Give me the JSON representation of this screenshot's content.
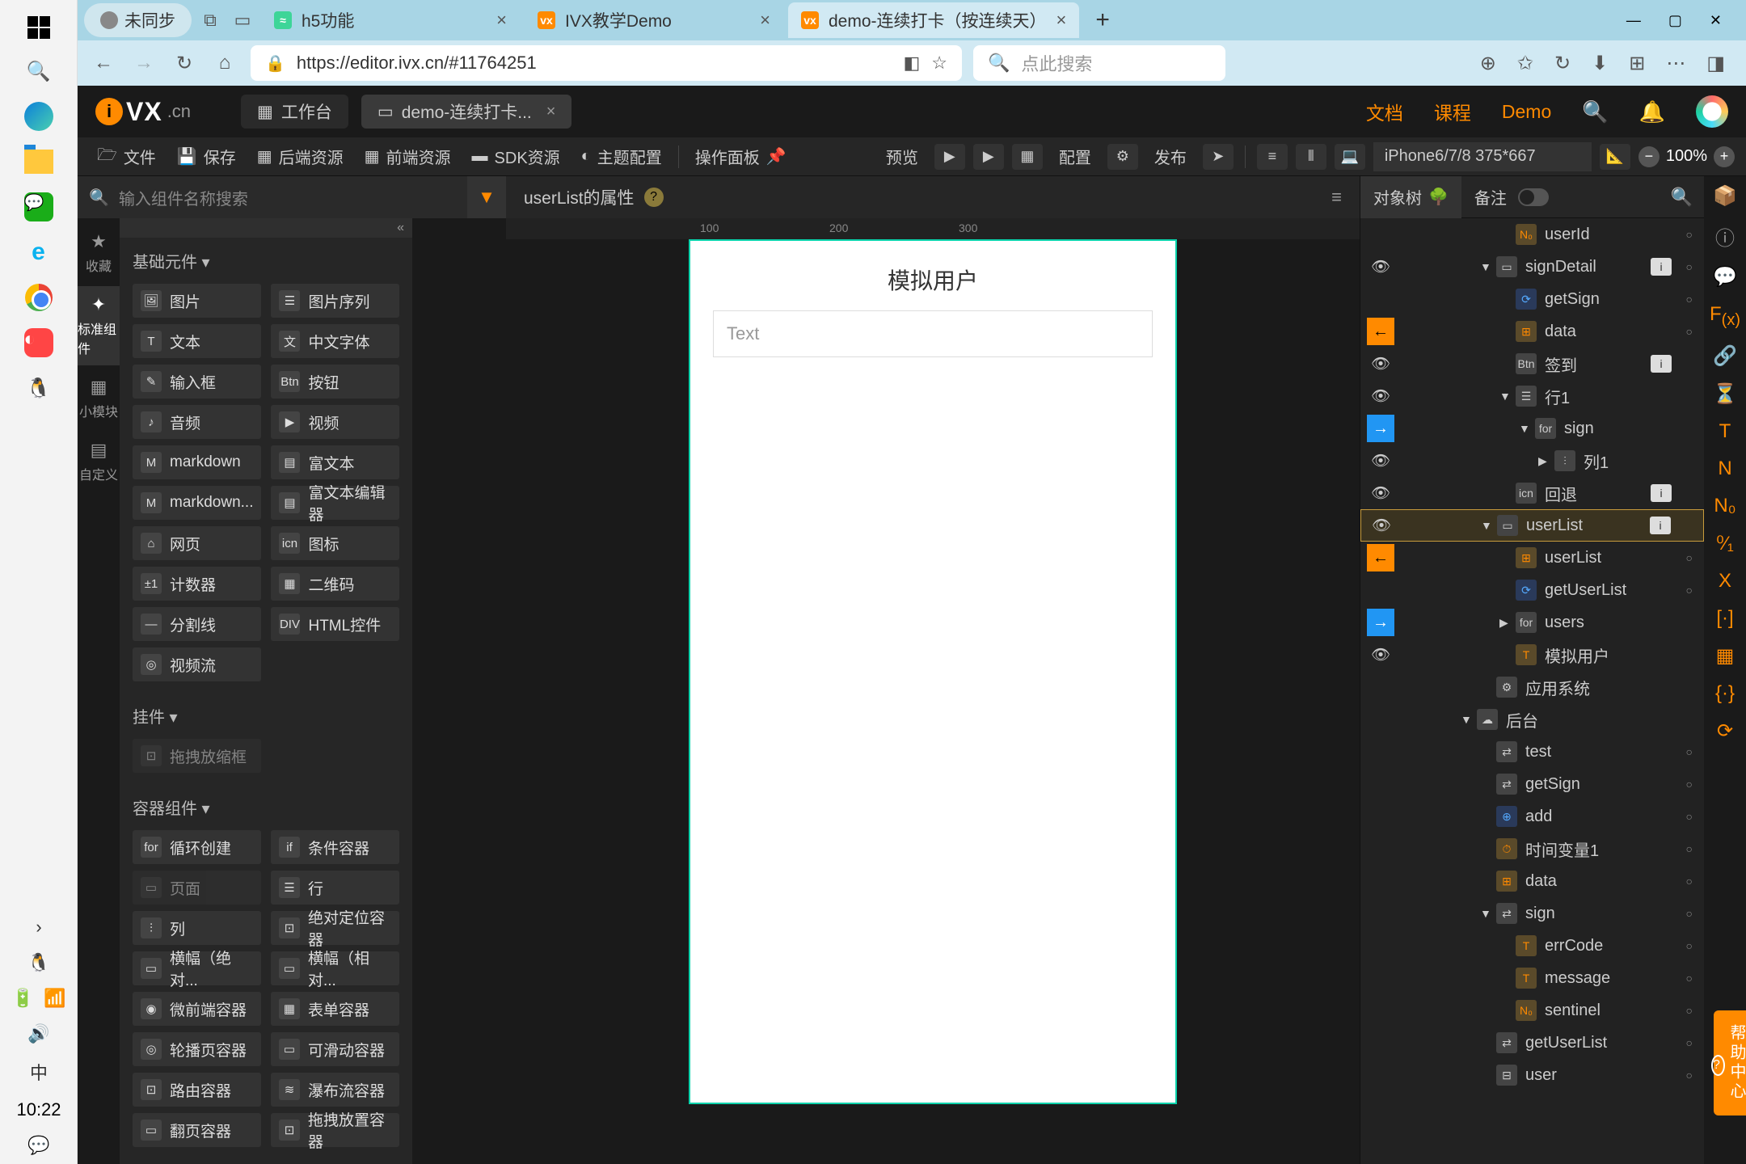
{
  "windows": {
    "time": "10:22",
    "profile_label": "未同步"
  },
  "browser": {
    "tabs": [
      {
        "label": "h5功能",
        "active": false
      },
      {
        "label": "IVX教学Demo",
        "active": false
      },
      {
        "label": "demo-连续打卡（按连续天）",
        "active": true
      }
    ],
    "url": "https://editor.ivx.cn/#11764251",
    "search_placeholder": "点此搜索"
  },
  "header": {
    "workspace": "工作台",
    "doc_tab": "demo-连续打卡...",
    "links": {
      "docs": "文档",
      "course": "课程",
      "demo": "Demo"
    }
  },
  "toolbar": {
    "file": "文件",
    "save": "保存",
    "backend": "后端资源",
    "frontend": "前端资源",
    "sdk": "SDK资源",
    "theme": "主题配置",
    "panel": "操作面板",
    "preview": "预览",
    "config": "配置",
    "publish": "发布",
    "device": "iPhone6/7/8 375*667",
    "zoom": "100%"
  },
  "component_search_placeholder": "输入组件名称搜索",
  "left_rail": [
    {
      "icon": "★",
      "label": "收藏"
    },
    {
      "icon": "✦",
      "label": "标准组件"
    },
    {
      "icon": "▦",
      "label": "小模块"
    },
    {
      "icon": "▤",
      "label": "自定义"
    }
  ],
  "sections": {
    "basic": "基础元件 ▾",
    "pendant": "挂件 ▾",
    "container": "容器组件 ▾"
  },
  "components": {
    "basic": [
      {
        "icon": "🖼",
        "label": "图片"
      },
      {
        "icon": "☰",
        "label": "图片序列"
      },
      {
        "icon": "T",
        "label": "文本"
      },
      {
        "icon": "文",
        "label": "中文字体"
      },
      {
        "icon": "✎",
        "label": "输入框"
      },
      {
        "icon": "Btn",
        "label": "按钮"
      },
      {
        "icon": "♪",
        "label": "音频"
      },
      {
        "icon": "▶",
        "label": "视频"
      },
      {
        "icon": "M",
        "label": "markdown"
      },
      {
        "icon": "▤",
        "label": "富文本"
      },
      {
        "icon": "M",
        "label": "markdown..."
      },
      {
        "icon": "▤",
        "label": "富文本编辑器"
      },
      {
        "icon": "⌂",
        "label": "网页"
      },
      {
        "icon": "icn",
        "label": "图标"
      },
      {
        "icon": "±1",
        "label": "计数器"
      },
      {
        "icon": "▦",
        "label": "二维码"
      },
      {
        "icon": "—",
        "label": "分割线"
      },
      {
        "icon": "DIV",
        "label": "HTML控件"
      },
      {
        "icon": "◎",
        "label": "视频流"
      }
    ],
    "pendant": [
      {
        "icon": "⊡",
        "label": "拖拽放缩框"
      }
    ],
    "container": [
      {
        "icon": "for",
        "label": "循环创建"
      },
      {
        "icon": "if",
        "label": "条件容器"
      },
      {
        "icon": "▭",
        "label": "页面"
      },
      {
        "icon": "☰",
        "label": "行"
      },
      {
        "icon": "⫶",
        "label": "列"
      },
      {
        "icon": "⊡",
        "label": "绝对定位容器"
      },
      {
        "icon": "▭",
        "label": "横幅（绝对..."
      },
      {
        "icon": "▭",
        "label": "横幅（相对..."
      },
      {
        "icon": "◉",
        "label": "微前端容器"
      },
      {
        "icon": "▦",
        "label": "表单容器"
      },
      {
        "icon": "◎",
        "label": "轮播页容器"
      },
      {
        "icon": "▭",
        "label": "可滑动容器"
      },
      {
        "icon": "⊡",
        "label": "路由容器"
      },
      {
        "icon": "≋",
        "label": "瀑布流容器"
      },
      {
        "icon": "▭",
        "label": "翻页容器"
      },
      {
        "icon": "⊡",
        "label": "拖拽放置容器"
      }
    ]
  },
  "props": {
    "title": "userList的属性"
  },
  "canvas": {
    "title": "模拟用户",
    "input_placeholder": "Text"
  },
  "tree": {
    "tab1": "对象树",
    "tab2": "备注",
    "items": [
      {
        "indent": 3,
        "icon": "N₀",
        "iconCls": "ti-orange",
        "label": "userId",
        "eye": "",
        "dot": true
      },
      {
        "indent": 2,
        "caret": "▼",
        "icon": "▭",
        "iconCls": "ti-gray",
        "label": "signDetail",
        "eye": "👁",
        "badge": "i",
        "dot": true
      },
      {
        "indent": 3,
        "icon": "⟳",
        "iconCls": "ti-blue",
        "label": "getSign",
        "eye": "",
        "dot": true
      },
      {
        "indent": 3,
        "icon": "⊞",
        "iconCls": "ti-orange",
        "label": "data",
        "arrow": "orange",
        "dot": true
      },
      {
        "indent": 3,
        "icon": "Btn",
        "iconCls": "ti-gray",
        "label": "签到",
        "eye": "👁",
        "badge": "i"
      },
      {
        "indent": 3,
        "caret": "▼",
        "icon": "☰",
        "iconCls": "ti-gray",
        "label": "行1",
        "eye": "👁"
      },
      {
        "indent": 4,
        "caret": "▼",
        "icon": "for",
        "iconCls": "ti-gray",
        "label": "sign",
        "arrow": "blue"
      },
      {
        "indent": 5,
        "caret": "▶",
        "icon": "⫶",
        "iconCls": "ti-gray",
        "label": "列1",
        "eye": "👁"
      },
      {
        "indent": 3,
        "icon": "icn",
        "iconCls": "ti-gray",
        "label": "回退",
        "eye": "👁",
        "badge": "i"
      },
      {
        "indent": 2,
        "caret": "▼",
        "icon": "▭",
        "iconCls": "ti-gray",
        "label": "userList",
        "eye": "👁",
        "badge": "i",
        "selected": true
      },
      {
        "indent": 3,
        "icon": "⊞",
        "iconCls": "ti-orange",
        "label": "userList",
        "arrow": "orange",
        "dot": true
      },
      {
        "indent": 3,
        "icon": "⟳",
        "iconCls": "ti-blue",
        "label": "getUserList",
        "dot": true
      },
      {
        "indent": 3,
        "caret": "▶",
        "icon": "for",
        "iconCls": "ti-gray",
        "label": "users",
        "arrow": "blue"
      },
      {
        "indent": 3,
        "icon": "T",
        "iconCls": "ti-orange",
        "label": "模拟用户",
        "eye": "👁"
      },
      {
        "indent": 2,
        "icon": "⚙",
        "iconCls": "ti-gray",
        "label": "应用系统"
      },
      {
        "indent": 1,
        "caret": "▼",
        "icon": "☁",
        "iconCls": "ti-gray",
        "label": "后台"
      },
      {
        "indent": 2,
        "icon": "⇄",
        "iconCls": "ti-gray",
        "label": "test",
        "dot": true
      },
      {
        "indent": 2,
        "icon": "⇄",
        "iconCls": "ti-gray",
        "label": "getSign",
        "dot": true
      },
      {
        "indent": 2,
        "icon": "⊕",
        "iconCls": "ti-blue",
        "label": "add",
        "dot": true
      },
      {
        "indent": 2,
        "icon": "⏱",
        "iconCls": "ti-orange",
        "label": "时间变量1",
        "dot": true
      },
      {
        "indent": 2,
        "icon": "⊞",
        "iconCls": "ti-orange",
        "label": "data",
        "dot": true
      },
      {
        "indent": 2,
        "caret": "▼",
        "icon": "⇄",
        "iconCls": "ti-gray",
        "label": "sign",
        "dot": true
      },
      {
        "indent": 3,
        "icon": "T",
        "iconCls": "ti-orange",
        "label": "errCode",
        "dot": true
      },
      {
        "indent": 3,
        "icon": "T",
        "iconCls": "ti-orange",
        "label": "message",
        "dot": true
      },
      {
        "indent": 3,
        "icon": "N₀",
        "iconCls": "ti-orange",
        "label": "sentinel",
        "dot": true
      },
      {
        "indent": 2,
        "icon": "⇄",
        "iconCls": "ti-gray",
        "label": "getUserList",
        "dot": true
      },
      {
        "indent": 2,
        "icon": "⊟",
        "iconCls": "ti-gray",
        "label": "user",
        "dot": true
      }
    ]
  },
  "help_label": "帮助中心"
}
